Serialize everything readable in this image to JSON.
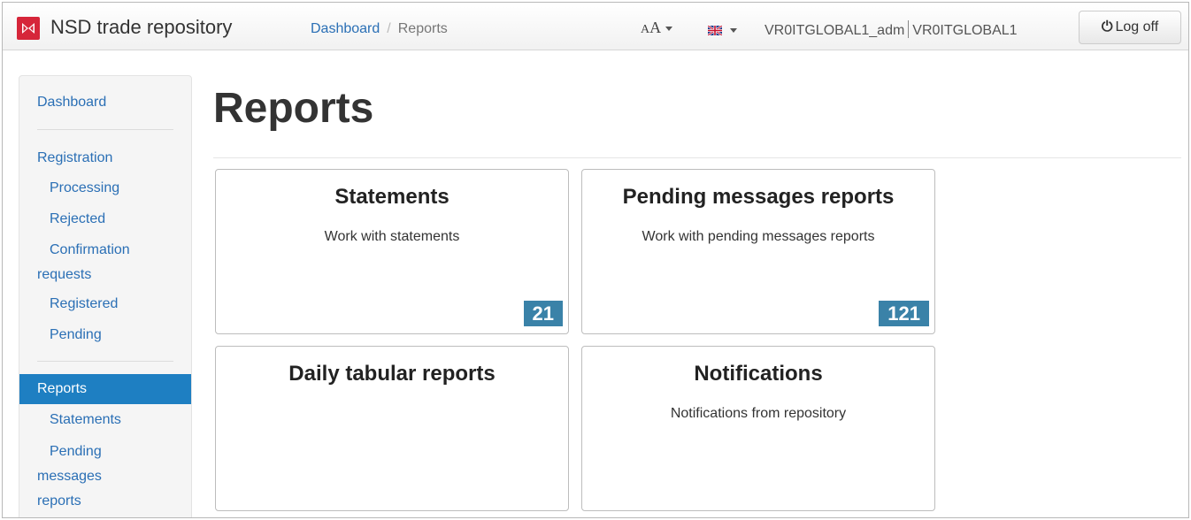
{
  "header": {
    "brand": "NSD trade repository",
    "breadcrumb": {
      "home": "Dashboard",
      "separator": "/",
      "current": "Reports"
    },
    "font_size_label": "A",
    "font_size_label_small": "A",
    "language_icon": "uk-flag-icon",
    "user_account": "VR0ITGLOBAL1_adm",
    "user_org": "VR0ITGLOBAL1",
    "logoff_label": "Log off",
    "accent_color": "#d6263a"
  },
  "sidebar": {
    "dashboard": "Dashboard",
    "registration": "Registration",
    "processing": "Processing",
    "rejected": "Rejected",
    "confirmation_line1": "Confirmation",
    "confirmation_line2": "requests",
    "registered": "Registered",
    "pending": "Pending",
    "reports": "Reports",
    "statements": "Statements",
    "pending_reports_line1": "Pending",
    "pending_reports_line2": "messages",
    "pending_reports_line3": "reports",
    "active_color": "#1e7fc2"
  },
  "main": {
    "title": "Reports",
    "cards": [
      {
        "title": "Statements",
        "description": "Work with statements",
        "count": "21"
      },
      {
        "title": "Pending messages reports",
        "description": "Work with pending messages reports",
        "count": "121"
      },
      {
        "title": "Daily tabular reports",
        "description": ""
      },
      {
        "title": "Notifications",
        "description": "Notifications from repository"
      }
    ],
    "badge_color": "#3a82a8"
  }
}
